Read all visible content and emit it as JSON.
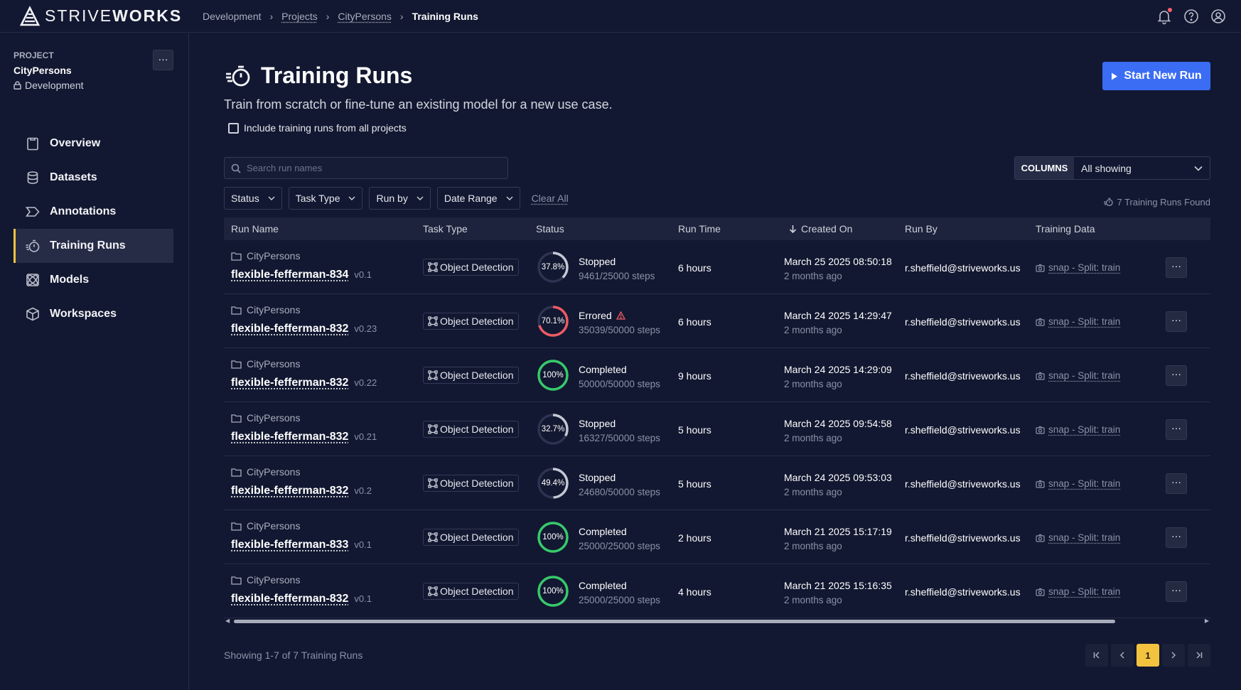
{
  "brand": {
    "name_light": "STRIVE",
    "name_bold": "WORKS"
  },
  "breadcrumb": [
    "Development",
    "Projects",
    "CityPersons",
    "Training Runs"
  ],
  "sidebar": {
    "kicker": "PROJECT",
    "project_name": "CityPersons",
    "environment": "Development",
    "menu_label": "···",
    "items": [
      {
        "label": "Overview",
        "icon": "clipboard-icon"
      },
      {
        "label": "Datasets",
        "icon": "database-icon"
      },
      {
        "label": "Annotations",
        "icon": "tag-icon"
      },
      {
        "label": "Training Runs",
        "icon": "stopwatch-icon"
      },
      {
        "label": "Models",
        "icon": "atom-icon"
      },
      {
        "label": "Workspaces",
        "icon": "cube-icon"
      }
    ]
  },
  "page": {
    "title": "Training Runs",
    "subtitle": "Train from scratch or fine-tune an existing model for a new use case.",
    "include_label": "Include training runs from all projects",
    "start_button": "Start New Run",
    "search_placeholder": "Search run names",
    "columns_label": "COLUMNS",
    "columns_value": "All showing",
    "filters": [
      "Status",
      "Task Type",
      "Run by",
      "Date Range"
    ],
    "clear_all": "Clear All",
    "found": "7 Training Runs Found",
    "showing": "Showing 1-7 of 7 Training Runs",
    "current_page": "1"
  },
  "table": {
    "headers": [
      "Run Name",
      "Task Type",
      "Status",
      "Run Time",
      "Created On",
      "Run By",
      "Training Data"
    ],
    "rows": [
      {
        "project": "CityPersons",
        "name": "flexible-fefferman-834",
        "version": "v0.1",
        "task": "Object Detection",
        "progress": 37.8,
        "pct": "37.8%",
        "status": "Stopped",
        "errored": false,
        "steps": "9461/25000 steps",
        "runtime": "6 hours",
        "created": "March 25 2025 08:50:18",
        "ago": "2 months ago",
        "runby": "r.sheffield@striveworks.us",
        "data": "snap - Split: train"
      },
      {
        "project": "CityPersons",
        "name": "flexible-fefferman-832",
        "version": "v0.23",
        "task": "Object Detection",
        "progress": 70.1,
        "pct": "70.1%",
        "status": "Errored",
        "errored": true,
        "steps": "35039/50000 steps",
        "runtime": "6 hours",
        "created": "March 24 2025 14:29:47",
        "ago": "2 months ago",
        "runby": "r.sheffield@striveworks.us",
        "data": "snap - Split: train"
      },
      {
        "project": "CityPersons",
        "name": "flexible-fefferman-832",
        "version": "v0.22",
        "task": "Object Detection",
        "progress": 100,
        "pct": "100%",
        "status": "Completed",
        "errored": false,
        "steps": "50000/50000 steps",
        "runtime": "9 hours",
        "created": "March 24 2025 14:29:09",
        "ago": "2 months ago",
        "runby": "r.sheffield@striveworks.us",
        "data": "snap - Split: train"
      },
      {
        "project": "CityPersons",
        "name": "flexible-fefferman-832",
        "version": "v0.21",
        "task": "Object Detection",
        "progress": 32.7,
        "pct": "32.7%",
        "status": "Stopped",
        "errored": false,
        "steps": "16327/50000 steps",
        "runtime": "5 hours",
        "created": "March 24 2025 09:54:58",
        "ago": "2 months ago",
        "runby": "r.sheffield@striveworks.us",
        "data": "snap - Split: train"
      },
      {
        "project": "CityPersons",
        "name": "flexible-fefferman-832",
        "version": "v0.2",
        "task": "Object Detection",
        "progress": 49.4,
        "pct": "49.4%",
        "status": "Stopped",
        "errored": false,
        "steps": "24680/50000 steps",
        "runtime": "5 hours",
        "created": "March 24 2025 09:53:03",
        "ago": "2 months ago",
        "runby": "r.sheffield@striveworks.us",
        "data": "snap - Split: train"
      },
      {
        "project": "CityPersons",
        "name": "flexible-fefferman-833",
        "version": "v0.1",
        "task": "Object Detection",
        "progress": 100,
        "pct": "100%",
        "status": "Completed",
        "errored": false,
        "steps": "25000/25000 steps",
        "runtime": "2 hours",
        "created": "March 21 2025 15:17:19",
        "ago": "2 months ago",
        "runby": "r.sheffield@striveworks.us",
        "data": "snap - Split: train"
      },
      {
        "project": "CityPersons",
        "name": "flexible-fefferman-832",
        "version": "v0.1",
        "task": "Object Detection",
        "progress": 100,
        "pct": "100%",
        "status": "Completed",
        "errored": false,
        "steps": "25000/25000 steps",
        "runtime": "4 hours",
        "created": "March 21 2025 15:16:35",
        "ago": "2 months ago",
        "runby": "r.sheffield@striveworks.us",
        "data": "snap - Split: train"
      }
    ]
  },
  "colors": {
    "accent": "#3a6cf4",
    "active_nav": "#f3c33f",
    "completed": "#37c96a",
    "errored": "#ee5a64",
    "stopped": "#c4c8d4",
    "background": "#121831"
  }
}
